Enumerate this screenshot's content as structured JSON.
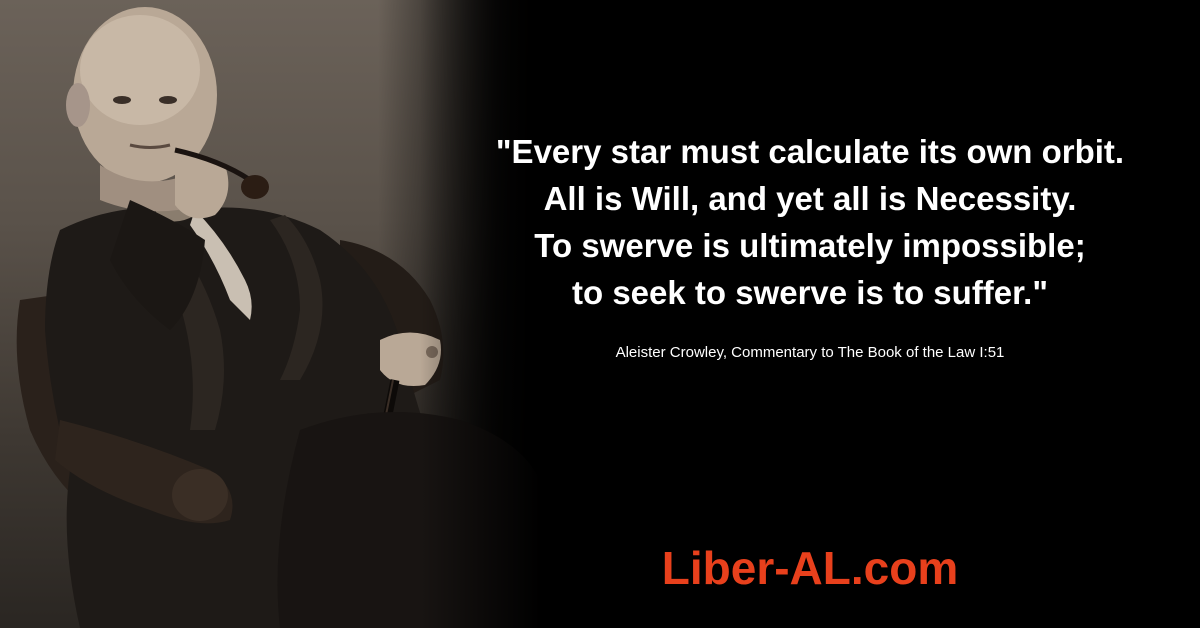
{
  "quote": {
    "lines": [
      "\"Every star must calculate its own orbit.",
      "All is Will, and yet all is Necessity.",
      "To swerve is ultimately impossible;",
      "to seek to swerve is to suffer.\""
    ]
  },
  "attribution": "Aleister Crowley, Commentary to The Book of the Law I:51",
  "site": {
    "label": "Liber-AL.com",
    "color": "#e8401c"
  },
  "photo": {
    "subject": "sepia portrait photograph"
  }
}
